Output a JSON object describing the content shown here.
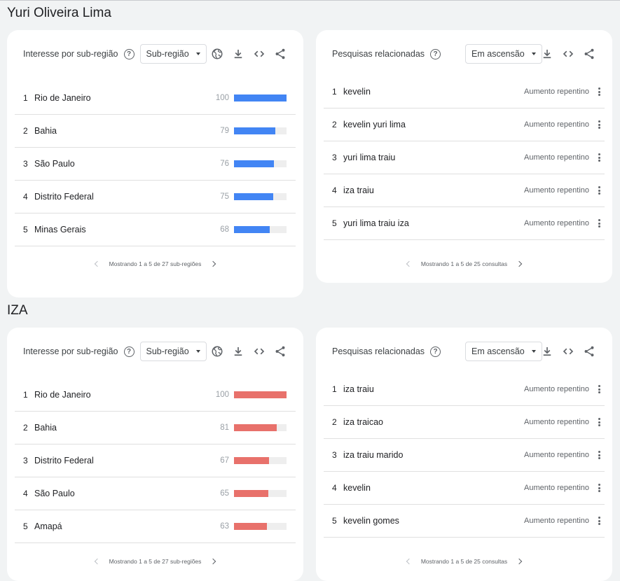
{
  "sections": [
    {
      "title": "Yuri Oliveira Lima",
      "bar_color": "#4285f4",
      "subregion": {
        "title": "Interesse por sub-região",
        "select": "Sub-região",
        "rows": [
          {
            "rank": "1",
            "label": "Rio de Janeiro",
            "value": 100
          },
          {
            "rank": "2",
            "label": "Bahia",
            "value": 79
          },
          {
            "rank": "3",
            "label": "São Paulo",
            "value": 76
          },
          {
            "rank": "4",
            "label": "Distrito Federal",
            "value": 75
          },
          {
            "rank": "5",
            "label": "Minas Gerais",
            "value": 68
          }
        ],
        "pager": "Mostrando 1 a 5 de 27 sub-regiões"
      },
      "related": {
        "title": "Pesquisas relacionadas",
        "select": "Em ascensão",
        "rows": [
          {
            "rank": "1",
            "label": "kevelin",
            "status": "Aumento repentino"
          },
          {
            "rank": "2",
            "label": "kevelin yuri lima",
            "status": "Aumento repentino"
          },
          {
            "rank": "3",
            "label": "yuri lima traiu",
            "status": "Aumento repentino"
          },
          {
            "rank": "4",
            "label": "iza traiu",
            "status": "Aumento repentino"
          },
          {
            "rank": "5",
            "label": "yuri lima traiu iza",
            "status": "Aumento repentino"
          }
        ],
        "pager": "Mostrando 1 a 5 de 25 consultas"
      }
    },
    {
      "title": "IZA",
      "bar_color": "#e8716b",
      "subregion": {
        "title": "Interesse por sub-região",
        "select": "Sub-região",
        "rows": [
          {
            "rank": "1",
            "label": "Rio de Janeiro",
            "value": 100
          },
          {
            "rank": "2",
            "label": "Bahia",
            "value": 81
          },
          {
            "rank": "3",
            "label": "Distrito Federal",
            "value": 67
          },
          {
            "rank": "4",
            "label": "São Paulo",
            "value": 65
          },
          {
            "rank": "5",
            "label": "Amapá",
            "value": 63
          }
        ],
        "pager": "Mostrando 1 a 5 de 27 sub-regiões"
      },
      "related": {
        "title": "Pesquisas relacionadas",
        "select": "Em ascensão",
        "rows": [
          {
            "rank": "1",
            "label": "iza traiu",
            "status": "Aumento repentino"
          },
          {
            "rank": "2",
            "label": "iza traicao",
            "status": "Aumento repentino"
          },
          {
            "rank": "3",
            "label": "iza traiu marido",
            "status": "Aumento repentino"
          },
          {
            "rank": "4",
            "label": "kevelin",
            "status": "Aumento repentino"
          },
          {
            "rank": "5",
            "label": "kevelin gomes",
            "status": "Aumento repentino"
          }
        ],
        "pager": "Mostrando 1 a 5 de 25 consultas"
      }
    }
  ]
}
